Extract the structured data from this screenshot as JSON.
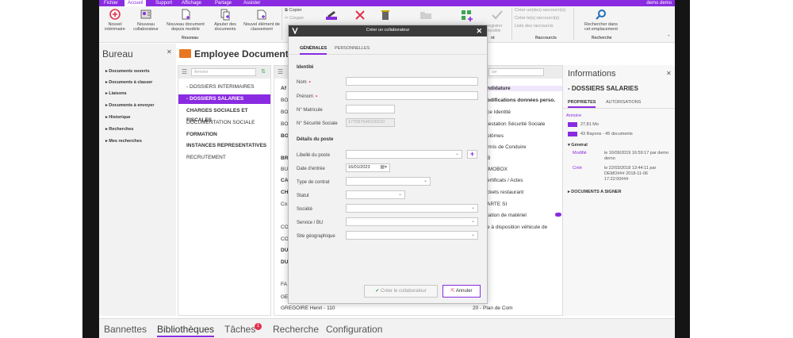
{
  "menubar": {
    "items": [
      "Fichier",
      "Accueil",
      "Support",
      "Affichage",
      "Partage",
      "Assister"
    ],
    "user": "demo demo"
  },
  "ribbon": {
    "buttons": [
      {
        "label": "Nouvel intérimaire",
        "icon": "add-person-icon"
      },
      {
        "label": "Nouveau collaborateur",
        "icon": "add-contact-icon"
      },
      {
        "label": "Nouveau document depuis modèle",
        "icon": "new-document-icon"
      },
      {
        "label": "Ajouter des documents",
        "icon": "add-documents-icon"
      },
      {
        "label": "Nouvel élément de classement",
        "icon": "new-folder-icon"
      }
    ],
    "group_nouveau": "Nouveau",
    "copy": "Copier",
    "cut": "Couper",
    "group_left_partial": "nt",
    "group_raccourcis": "Raccourcis",
    "group_recherche": "Recherche",
    "shortcut_items": [
      "Créer un(des) raccourci(s)",
      "Créer le(s) raccourci(s)",
      "Liste des raccourcis"
    ],
    "search_button": "Rechercher dans cet emplacement",
    "register_partial": "registrer\nmodèle"
  },
  "left_panel": {
    "title": "Bureau",
    "items": [
      "Documents ouverts",
      "Documents à classer",
      "Liaisons",
      "Documents à envoyer",
      "Historique",
      "Recherches",
      "Mes recherches"
    ]
  },
  "document": {
    "title": "Employee Document"
  },
  "tree": {
    "search_placeholder": "Armoire",
    "items": [
      {
        "label": "- DOSSIERS INTERIMAIRES",
        "style": "normal"
      },
      {
        "label": "- DOSSIERS SALARIES",
        "style": "selected"
      },
      {
        "label": "CHARGES SOCIALES ET FISCALES",
        "style": "bold"
      },
      {
        "label": "DOCUMENTATION SOCIALE",
        "style": "normal"
      },
      {
        "label": "FORMATION",
        "style": "bold"
      },
      {
        "label": "INSTANCES REPRESENTATIVES",
        "style": "bold"
      },
      {
        "label": "RECRUTEMENT",
        "style": "normal"
      }
    ]
  },
  "list": {
    "left_column": [
      "Af",
      "BO",
      "BO",
      "BO",
      "BO",
      "BR",
      "BU",
      "CA",
      "CH",
      "Co",
      "CO",
      "CO",
      "DU",
      "DU",
      "FA",
      "GE",
      "GREGOIRE Henri - 110"
    ],
    "right_column": [
      "ndidature",
      "odifications données perso.",
      "ce Identité",
      "testation Sécurité Sociale",
      "plômes",
      "rmis de Conduire",
      "B",
      "IMOBOX",
      "ertificats / Actes",
      "ckets restaurant",
      "ARTE SI",
      "tation de matériel",
      "e à disposition véhicule de",
      "20 - Plan de Com"
    ],
    "right_search": "ser"
  },
  "info": {
    "title": "Informations",
    "subtitle": "- DOSSIERS SALARIES",
    "tabs": [
      "PROPRIETES",
      "AUTORISATIONS"
    ],
    "armoire_label": "Armoire",
    "size": "27,81 Mo",
    "rayons": "43 Rayons - 45 documents",
    "general_label": "Général",
    "modifie_label": "Modifié",
    "modifie_value": "le 16/09/2019 16:59:17 par demo demo",
    "cree_label": "Créé",
    "cree_value": "le 22/03/2018 13:44:11 par DEMO### 2018-11-06 17:22:00###",
    "docs_to_sign": "DOCUMENTS A SIGNER"
  },
  "bottom": {
    "tabs": [
      "Bannettes",
      "Bibliothèques",
      "Tâches",
      "Recherche",
      "Configuration"
    ],
    "active": "Bibliothèques",
    "tasks_badge": "1"
  },
  "modal": {
    "title": "Créer un collaborateur",
    "tabs": [
      "GÉNÉRALES",
      "PERSONNELLES"
    ],
    "identity_heading": "Identité",
    "fields_identity": [
      {
        "label": "Nom",
        "required": true,
        "value": ""
      },
      {
        "label": "Prénom",
        "required": true,
        "value": ""
      },
      {
        "label": "N° Matricule",
        "required": false,
        "value": ""
      },
      {
        "label": "N° Sécurité Sociale",
        "required": false,
        "value": "177097645100210"
      }
    ],
    "post_heading": "Détails du poste",
    "fields_post": [
      {
        "label": "Libellé du poste",
        "value": ""
      },
      {
        "label": "Date d'entrée",
        "value": "16/01/2023"
      },
      {
        "label": "Type de contrat",
        "value": ""
      },
      {
        "label": "Statut",
        "value": ""
      },
      {
        "label": "Société",
        "value": ""
      },
      {
        "label": "Service / BU",
        "value": ""
      },
      {
        "label": "Site géographique",
        "value": ""
      }
    ],
    "create_button": "Créer le collaborateur",
    "cancel_button": "Annuler"
  },
  "colors": {
    "accent": "#8a2be2",
    "header": "#3b3b3b",
    "required": "#e3324f",
    "folder": "#e87722"
  }
}
